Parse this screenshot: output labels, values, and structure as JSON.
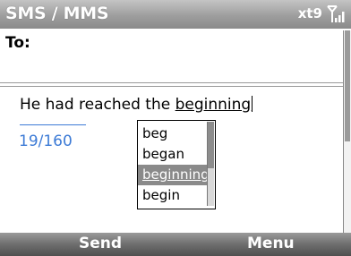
{
  "titlebar": {
    "title": "SMS / MMS",
    "input_mode": "xt9",
    "signal_icon": "signal-strength-icon"
  },
  "to_field": {
    "label": "To:"
  },
  "message": {
    "text_prefix": "He had reached the ",
    "current_word": "beginning"
  },
  "counter": {
    "text": "19/160",
    "color": "#3d7bd6"
  },
  "suggestions": {
    "items": [
      "beg",
      "began",
      "beginning",
      "begin"
    ],
    "selected": "beginning"
  },
  "softkeys": {
    "left": "Send",
    "right": "Menu"
  }
}
